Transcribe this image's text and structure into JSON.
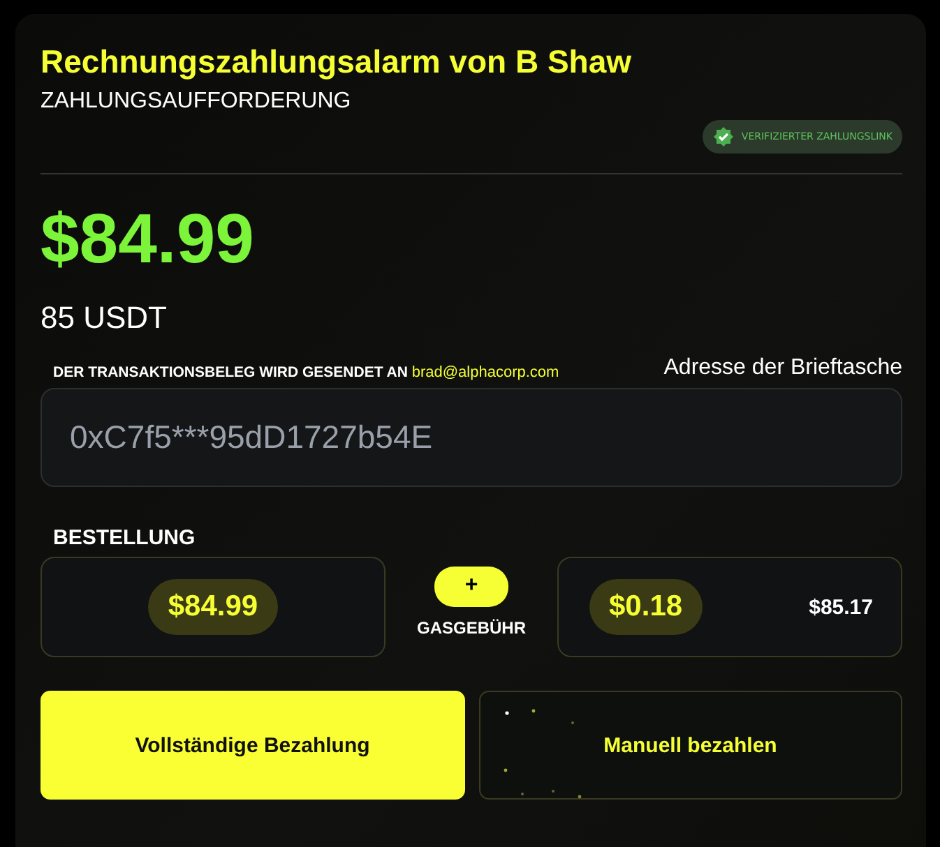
{
  "header": {
    "title": "Rechnungszahlungsalarm von B Shaw",
    "subtitle": "ZAHLUNGSAUFFORDERUNG",
    "badge": "VERIFIZIERTER ZAHLUNGSLINK"
  },
  "amount": {
    "price": "$84.99",
    "crypto": "85 USDT"
  },
  "receipt": {
    "text": "DER TRANSAKTIONSBELEG WIRD GESENDET AN",
    "email": "brad@alphacorp.com"
  },
  "wallet": {
    "label": "Adresse der Brieftasche",
    "value": "0xC7f5***95dD1727b54E"
  },
  "order": {
    "heading": "BESTELLUNG",
    "order_amount": "$84.99",
    "plus": "+",
    "fee_label": "GASGEBÜHR",
    "fee_amount": "$0.18",
    "total": "$85.17"
  },
  "buttons": [
    {
      "label": "Vollständige Bezahlung",
      "kind": "primary"
    },
    {
      "label": "Manuell bezahlen",
      "kind": "secondary"
    }
  ]
}
